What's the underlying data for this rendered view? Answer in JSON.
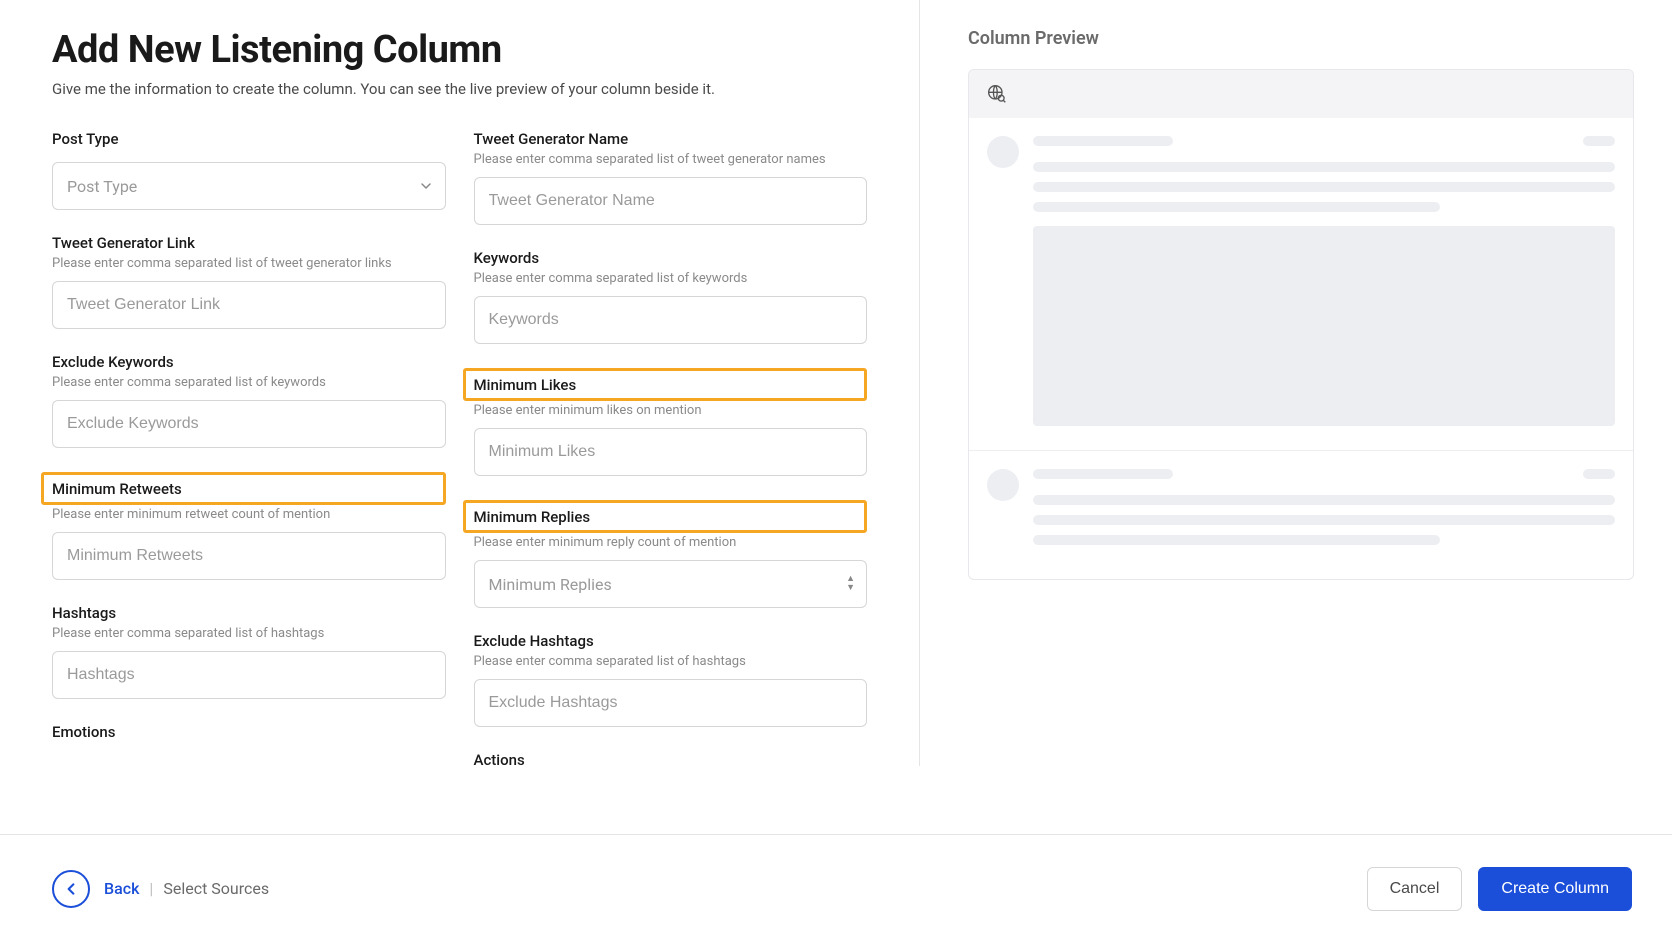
{
  "page": {
    "title": "Add New Listening Column",
    "subtitle": "Give me the information to create the column. You can see the live preview of your column beside it."
  },
  "left": {
    "post_type": {
      "label": "Post Type",
      "placeholder": "Post Type"
    },
    "tweet_gen_link": {
      "label": "Tweet Generator Link",
      "hint": "Please enter comma separated list of tweet generator links",
      "placeholder": "Tweet Generator Link"
    },
    "exclude_keywords": {
      "label": "Exclude Keywords",
      "hint": "Please enter comma separated list of keywords",
      "placeholder": "Exclude Keywords"
    },
    "min_retweets": {
      "label": "Minimum Retweets",
      "hint": "Please enter minimum retweet count of mention",
      "placeholder": "Minimum Retweets"
    },
    "hashtags": {
      "label": "Hashtags",
      "hint": "Please enter comma separated list of hashtags",
      "placeholder": "Hashtags"
    },
    "emotions": {
      "label": "Emotions"
    }
  },
  "right": {
    "tweet_gen_name": {
      "label": "Tweet Generator Name",
      "hint": "Please enter comma separated list of tweet generator names",
      "placeholder": "Tweet Generator Name"
    },
    "keywords": {
      "label": "Keywords",
      "hint": "Please enter comma separated list of keywords",
      "placeholder": "Keywords"
    },
    "min_likes": {
      "label": "Minimum Likes",
      "hint": "Please enter minimum likes on mention",
      "placeholder": "Minimum Likes"
    },
    "min_replies": {
      "label": "Minimum Replies",
      "hint": "Please enter minimum reply count of mention",
      "placeholder": "Minimum Replies"
    },
    "exclude_hashtags": {
      "label": "Exclude Hashtags",
      "hint": "Please enter comma separated list of hashtags",
      "placeholder": "Exclude Hashtags"
    },
    "actions": {
      "label": "Actions"
    }
  },
  "preview": {
    "title": "Column Preview"
  },
  "footer": {
    "back": "Back",
    "crumb_current": "Select Sources",
    "cancel": "Cancel",
    "create": "Create Column"
  }
}
